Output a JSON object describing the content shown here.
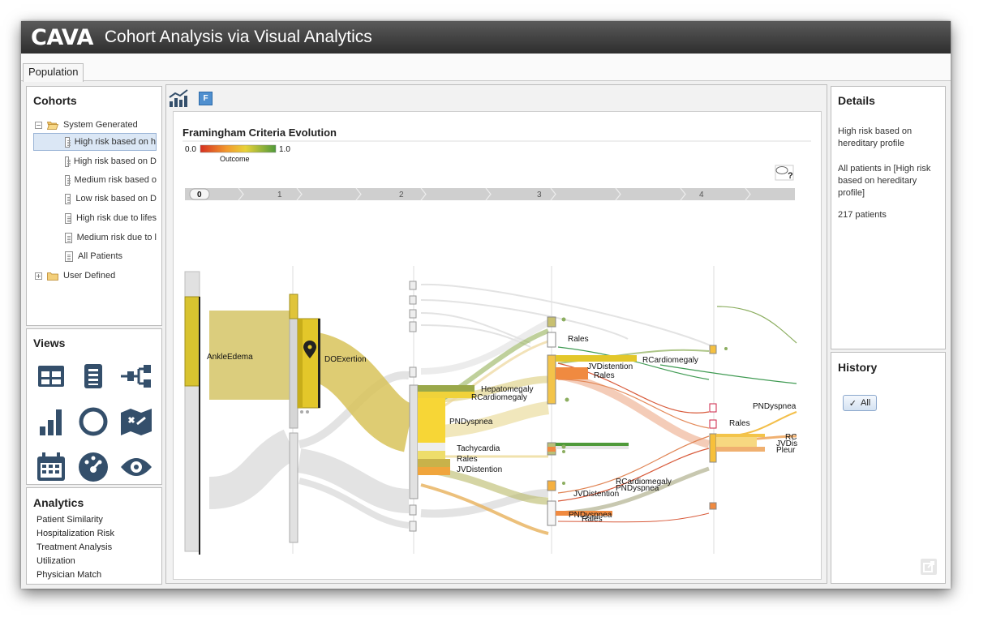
{
  "app": {
    "logo": "CAVA",
    "subtitle": "Cohort Analysis via Visual Analytics"
  },
  "tabs": [
    {
      "label": "Population"
    }
  ],
  "cohorts": {
    "title": "Cohorts",
    "system_generated": {
      "label": "System Generated",
      "items": [
        {
          "label": "High risk based on h"
        },
        {
          "label": "High risk based on D"
        },
        {
          "label": "Medium risk based o"
        },
        {
          "label": "Low risk based on D"
        },
        {
          "label": "High risk due to lifes"
        },
        {
          "label": "Medium risk due to l"
        },
        {
          "label": "All Patients"
        }
      ]
    },
    "user_defined": {
      "label": "User Defined"
    }
  },
  "views": {
    "title": "Views"
  },
  "analytics": {
    "title": "Analytics",
    "items": [
      "Patient Similarity",
      "Hospitalization Risk",
      "Treatment Analysis",
      "Utilization",
      "Physician Match"
    ]
  },
  "toolbar": {
    "filter_badge": "F"
  },
  "visualization": {
    "title": "Framingham Criteria Evolution",
    "legend": {
      "min": "0.0",
      "max": "1.0",
      "label": "Outcome"
    },
    "help": "?",
    "timeline": [
      "0",
      "1",
      "2",
      "3",
      "4"
    ],
    "nodes": {
      "ankle_edema": "AnkleEdema",
      "doexertion": "DOExertion",
      "hepatomegaly": "Hepatomegaly",
      "rcardiomegaly": "RCardiomegaly",
      "pndyspnea": "PNDyspnea",
      "tachycardia": "Tachycardia",
      "rales": "Rales",
      "jvdistention": "JVDistention",
      "s3_rales": "Rales",
      "s3_rcardiomegaly": "RCardiomegaly",
      "s3_jvdistention": "JVDistention",
      "s3_rales2": "Rales",
      "s3_rcardiomegaly2": "RCardiomegaly",
      "s3_pndyspnea": "PNDyspnea",
      "s3_jvdistention2": "JVDistention",
      "s3_pndyspnea2": "PNDyspnea",
      "s3_rales3": "Rales",
      "s4_pndyspnea": "PNDyspnea",
      "s4_rales": "Rales",
      "s4_rc": "RC",
      "s4_jvdis": "JVDis",
      "s4_pleur": "Pleur"
    }
  },
  "details": {
    "title": "Details",
    "line1": "High risk based on hereditary profile",
    "line2": "All patients in [High risk based on hereditary profile]",
    "line3": "217 patients"
  },
  "history": {
    "title": "History",
    "button": "All",
    "check": "✓"
  },
  "colors": {
    "titlebar": "#3a3a3a",
    "selection": "#dbe7f5",
    "flow_yellow": "#d8c35a",
    "node_yellow": "#e3c72a"
  }
}
